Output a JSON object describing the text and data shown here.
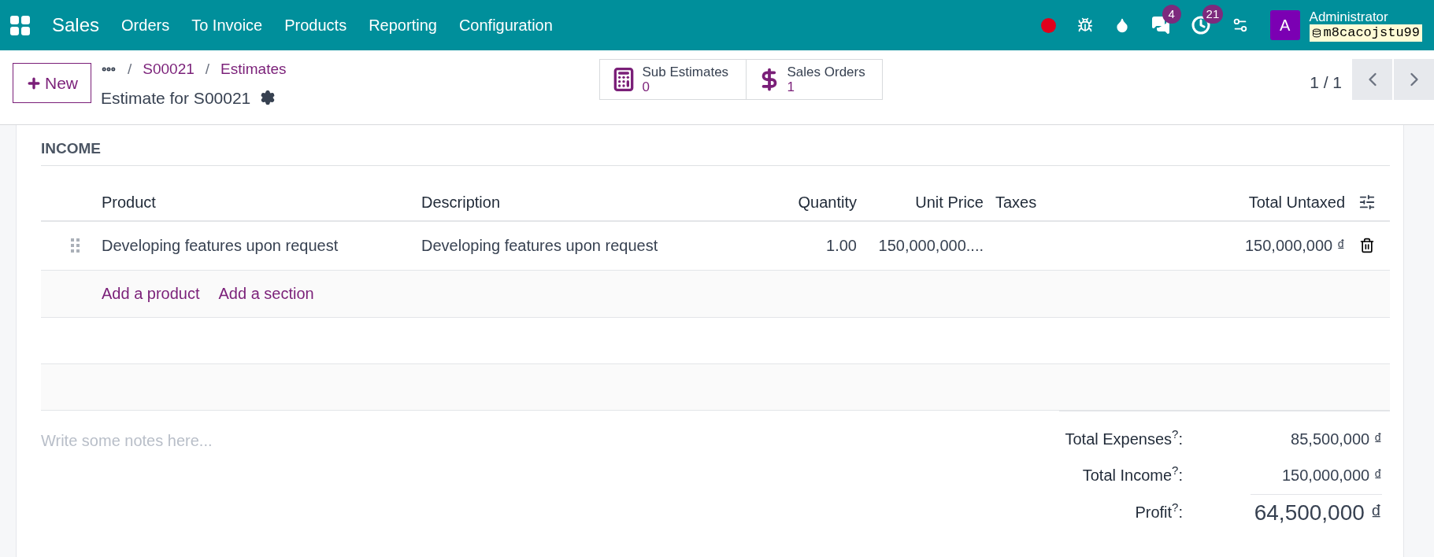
{
  "navbar": {
    "app_name": "Sales",
    "menu": [
      "Orders",
      "To Invoice",
      "Products",
      "Reporting",
      "Configuration"
    ],
    "systray": [
      {
        "kind": "record"
      },
      {
        "kind": "debug"
      },
      {
        "kind": "drop"
      },
      {
        "kind": "chat",
        "count": "4"
      },
      {
        "kind": "clock",
        "count": "21"
      },
      {
        "kind": "gears"
      }
    ],
    "avatar": "A",
    "user": "Administrator",
    "database": "m8cacojstu99"
  },
  "control_panel": {
    "new_button": "New",
    "breadcrumbs": [
      "S00021",
      "Estimates"
    ],
    "separator": "/",
    "title": "Estimate for S00021",
    "smart_buttons": [
      {
        "kind": "calculator",
        "label": "Sub Estimates",
        "value": "0"
      },
      {
        "kind": "dollar",
        "label": "Sales Orders",
        "value": "1"
      }
    ],
    "pager": "1 / 1"
  },
  "section": {
    "title": "INCOME"
  },
  "table": {
    "columns": [
      "Product",
      "Description",
      "Quantity",
      "Unit Price",
      "Taxes",
      "Total Untaxed"
    ],
    "rows": [
      {
        "product": "Developing features upon request",
        "description": "Developing features upon request",
        "quantity": "1.00",
        "unit_price": "150,000,000....",
        "total": "150,000,000 ₫"
      }
    ],
    "add_links": [
      "Add a product",
      "Add a section"
    ]
  },
  "notes": {
    "placeholder": "Write some notes here..."
  },
  "totals": [
    {
      "kind": "normal",
      "label": "Total Expenses$^{?}$:",
      "value": "85,500,000 ₫"
    },
    {
      "kind": "normal",
      "label": "Total Income$^{?}$:",
      "value": "150,000,000 ₫"
    },
    {
      "kind": "grand",
      "label": "Profit$^{?}$:",
      "value": "64,500,000 ₫"
    }
  ]
}
